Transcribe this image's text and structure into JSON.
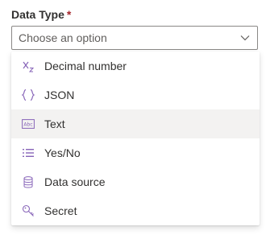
{
  "field": {
    "label": "Data Type",
    "required_marker": "*",
    "placeholder": "Choose an option"
  },
  "options": [
    {
      "label": "Decimal number",
      "icon": "decimal-number-icon"
    },
    {
      "label": "JSON",
      "icon": "json-braces-icon"
    },
    {
      "label": "Text",
      "icon": "text-icon",
      "hovered": true
    },
    {
      "label": "Yes/No",
      "icon": "yes-no-list-icon"
    },
    {
      "label": "Data source",
      "icon": "database-icon"
    },
    {
      "label": "Secret",
      "icon": "key-icon"
    }
  ],
  "colors": {
    "accent": "#8764b8",
    "required": "#a4262c",
    "hover": "#f3f2f1",
    "border": "#8a8886"
  }
}
